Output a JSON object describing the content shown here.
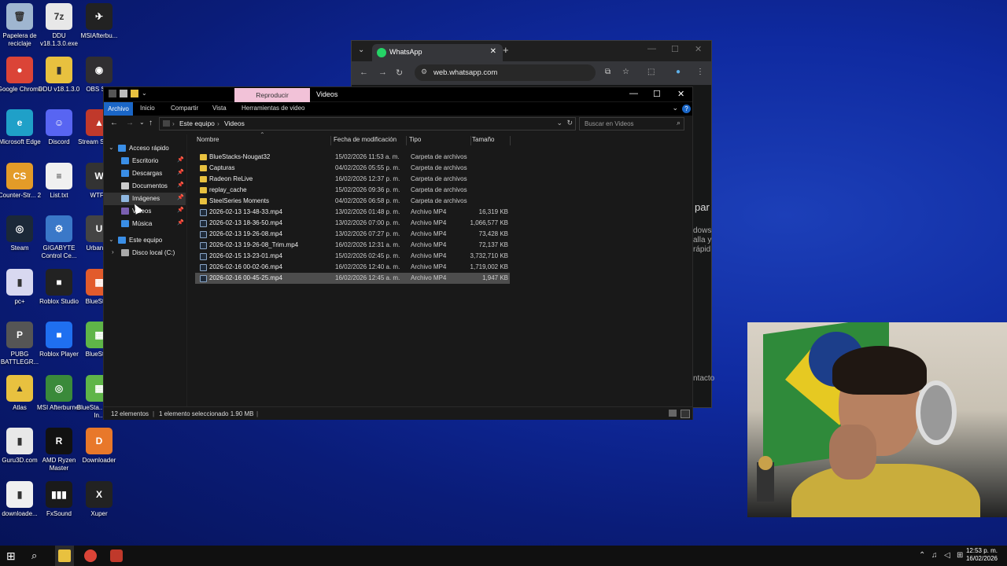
{
  "desktop": {
    "icons": [
      {
        "label": "Papelera de reciclaje",
        "glyph": "🗑",
        "color": "#9fb6d0"
      },
      {
        "label": "DDU v18.1.3.0.exe",
        "glyph": "7z",
        "color": "#e8e8e8"
      },
      {
        "label": "MSIAfterbu...",
        "glyph": "✈",
        "color": "#222222"
      },
      {
        "label": "Google Chrome",
        "glyph": "●",
        "color": "#db4437"
      },
      {
        "label": "DDU v18.1.3.0",
        "glyph": "▮",
        "color": "#e8c13f"
      },
      {
        "label": "OBS St...",
        "glyph": "◉",
        "color": "#302e31"
      },
      {
        "label": "Microsoft Edge",
        "glyph": "e",
        "color": "#1fa0c8"
      },
      {
        "label": "Discord",
        "glyph": "☺",
        "color": "#5865f2"
      },
      {
        "label": "Stream SE.Li...",
        "glyph": "▲",
        "color": "#c0392b"
      },
      {
        "label": "Counter-Str... 2",
        "glyph": "CS",
        "color": "#e39b28"
      },
      {
        "label": "List.txt",
        "glyph": "≡",
        "color": "#f0f0f0"
      },
      {
        "label": "WTF...",
        "glyph": "W",
        "color": "#333333"
      },
      {
        "label": "Steam",
        "glyph": "◎",
        "color": "#1b2838"
      },
      {
        "label": "GIGABYTE Control Ce...",
        "glyph": "⚙",
        "color": "#3a78c8"
      },
      {
        "label": "UrbanV...",
        "glyph": "U",
        "color": "#444444"
      },
      {
        "label": "pc+",
        "glyph": "▮",
        "color": "#d8d8f0"
      },
      {
        "label": "Roblox Studio",
        "glyph": "■",
        "color": "#222222"
      },
      {
        "label": "BlueSta...",
        "glyph": "▦",
        "color": "#e25b2c"
      },
      {
        "label": "PUBG BATTLEGR...",
        "glyph": "P",
        "color": "#555555"
      },
      {
        "label": "Roblox Player",
        "glyph": "■",
        "color": "#1f6ff0"
      },
      {
        "label": "BlueSta...",
        "glyph": "▦",
        "color": "#5fb548"
      },
      {
        "label": "Atlas",
        "glyph": "▲",
        "color": "#e8c13f"
      },
      {
        "label": "MSI Afterburner",
        "glyph": "◎",
        "color": "#3a8a3a"
      },
      {
        "label": "BlueSta... Multi-In...",
        "glyph": "▦",
        "color": "#5fb548"
      },
      {
        "label": "Guru3D.com",
        "glyph": "▮",
        "color": "#e8e8e8"
      },
      {
        "label": "AMD Ryzen Master",
        "glyph": "R",
        "color": "#111111"
      },
      {
        "label": "Downloader",
        "glyph": "D",
        "color": "#e8782a"
      },
      {
        "label": "downloade...",
        "glyph": "▮",
        "color": "#f0f0f0"
      },
      {
        "label": "FxSound",
        "glyph": "▮▮▮",
        "color": "#1a1a1a"
      },
      {
        "label": "Xuper",
        "glyph": "X",
        "color": "#222222"
      }
    ]
  },
  "chrome": {
    "tab_title": "WhatsApp",
    "url": "web.whatsapp.com",
    "partial_text": [
      "par",
      "dows",
      "alla y",
      "rápid",
      "ntacto"
    ]
  },
  "explorer": {
    "ribbon_context": "Reproducir",
    "window_title": "Videos",
    "tabs": [
      "Archivo",
      "Inicio",
      "Compartir",
      "Vista",
      "Herramientas de video"
    ],
    "path": [
      "Este equipo",
      "Videos"
    ],
    "search_placeholder": "Buscar en Videos",
    "columns": [
      "Nombre",
      "Fecha de modificación",
      "Tipo",
      "Tamaño"
    ],
    "nav": [
      {
        "label": "Acceso rápido",
        "icon": "star-icon",
        "color": "#3a8ee6",
        "indent": 0,
        "pin": false
      },
      {
        "label": "Escritorio",
        "icon": "desktop-icon",
        "color": "#3a8ee6",
        "indent": 1,
        "pin": true
      },
      {
        "label": "Descargas",
        "icon": "download-icon",
        "color": "#3a8ee6",
        "indent": 1,
        "pin": true
      },
      {
        "label": "Documentos",
        "icon": "documents-icon",
        "color": "#cccccc",
        "indent": 1,
        "pin": true
      },
      {
        "label": "Imágenes",
        "icon": "images-icon",
        "color": "#8fb7e0",
        "indent": 1,
        "pin": true
      },
      {
        "label": "Videos",
        "icon": "videos-icon",
        "color": "#7a5fb0",
        "indent": 1,
        "pin": true
      },
      {
        "label": "Música",
        "icon": "music-icon",
        "color": "#3a8ee6",
        "indent": 1,
        "pin": true
      },
      {
        "label": "Este equipo",
        "icon": "pc-icon",
        "color": "#3a8ee6",
        "indent": 0,
        "pin": false
      },
      {
        "label": "Disco local (C:)",
        "icon": "drive-icon",
        "color": "#aaaaaa",
        "indent": 1,
        "pin": false
      }
    ],
    "files": [
      {
        "name": "BlueStacks-Nougat32",
        "date": "15/02/2026 11:53 a. m.",
        "type": "Carpeta de archivos",
        "size": "",
        "kind": "folder"
      },
      {
        "name": "Capturas",
        "date": "04/02/2026 05:55 p. m.",
        "type": "Carpeta de archivos",
        "size": "",
        "kind": "folder"
      },
      {
        "name": "Radeon ReLive",
        "date": "16/02/2026 12:37 p. m.",
        "type": "Carpeta de archivos",
        "size": "",
        "kind": "folder"
      },
      {
        "name": "replay_cache",
        "date": "15/02/2026 09:36 p. m.",
        "type": "Carpeta de archivos",
        "size": "",
        "kind": "folder"
      },
      {
        "name": "SteelSeries Moments",
        "date": "04/02/2026 06:58 p. m.",
        "type": "Carpeta de archivos",
        "size": "",
        "kind": "folder"
      },
      {
        "name": "2026-02-13 13-48-33.mp4",
        "date": "13/02/2026 01:48 p. m.",
        "type": "Archivo MP4",
        "size": "16,319 KB",
        "kind": "video"
      },
      {
        "name": "2026-02-13 18-36-50.mp4",
        "date": "13/02/2026 07:00 p. m.",
        "type": "Archivo MP4",
        "size": "1,066,577 KB",
        "kind": "video"
      },
      {
        "name": "2026-02-13 19-26-08.mp4",
        "date": "13/02/2026 07:27 p. m.",
        "type": "Archivo MP4",
        "size": "73,428 KB",
        "kind": "video"
      },
      {
        "name": "2026-02-13 19-26-08_Trim.mp4",
        "date": "16/02/2026 12:31 a. m.",
        "type": "Archivo MP4",
        "size": "72,137 KB",
        "kind": "video"
      },
      {
        "name": "2026-02-15 13-23-01.mp4",
        "date": "15/02/2026 02:45 p. m.",
        "type": "Archivo MP4",
        "size": "3,732,710 KB",
        "kind": "video"
      },
      {
        "name": "2026-02-16 00-02-06.mp4",
        "date": "16/02/2026 12:40 a. m.",
        "type": "Archivo MP4",
        "size": "1,719,002 KB",
        "kind": "video"
      },
      {
        "name": "2026-02-16 00-45-25.mp4",
        "date": "16/02/2026 12:45 a. m.",
        "type": "Archivo MP4",
        "size": "1,947 KB",
        "kind": "video",
        "selected": true
      }
    ],
    "status": {
      "count": "12 elementos",
      "selection": "1 elemento seleccionado  1.90 MB"
    }
  },
  "taskbar": {
    "time": "12:53 p. m.",
    "date": "16/02/2026"
  }
}
